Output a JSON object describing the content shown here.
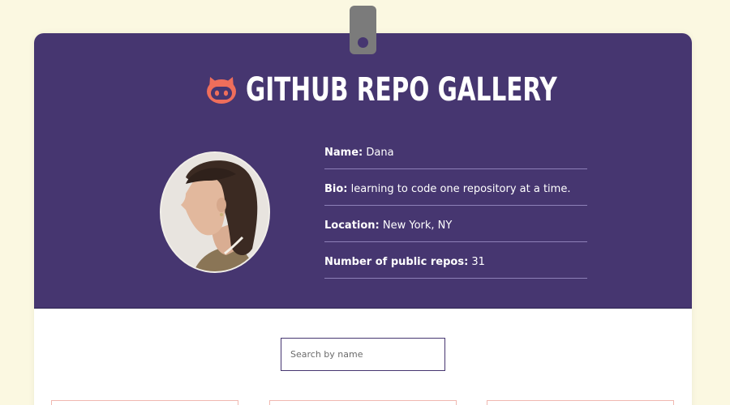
{
  "header": {
    "title": "GITHUB REPO GALLERY",
    "logo_icon": "octocat-icon",
    "logo_color": "#ef6e5b",
    "background_color": "#463670"
  },
  "profile": {
    "avatar_alt": "Profile photo of Dana",
    "fields": [
      {
        "label": "Name:",
        "value": "Dana"
      },
      {
        "label": "Bio:",
        "value": "learning to code one repository at a time."
      },
      {
        "label": "Location:",
        "value": "New York, NY"
      },
      {
        "label": "Number of public repos:",
        "value": "31"
      }
    ]
  },
  "search": {
    "placeholder": "Search by name",
    "value": ""
  },
  "page_background": "#fbf8e1",
  "repo_cards_visible": 3
}
